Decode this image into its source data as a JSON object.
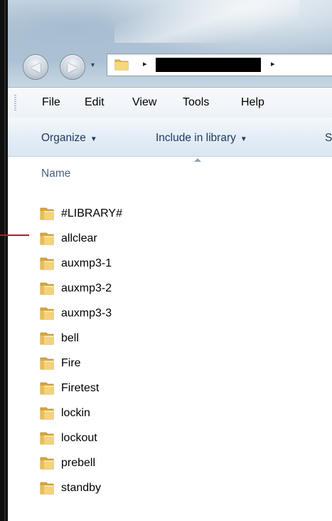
{
  "window": {
    "address_path_arrow_1": "▸",
    "address_path_arrow_2": "▸"
  },
  "navigation": {
    "back_icon": "arrow-left-icon",
    "forward_icon": "arrow-right-icon",
    "recent_icon": "chevron-down-icon"
  },
  "menubar": {
    "file": "File",
    "edit": "Edit",
    "view": "View",
    "tools": "Tools",
    "help": "Help"
  },
  "commandbar": {
    "organize": "Organize",
    "include_in_library": "Include in library",
    "share_truncated": "S",
    "caret": "▼"
  },
  "list": {
    "column_name": "Name",
    "items": [
      {
        "name": "#LIBRARY#"
      },
      {
        "name": "allclear"
      },
      {
        "name": "auxmp3-1"
      },
      {
        "name": "auxmp3-2"
      },
      {
        "name": "auxmp3-3"
      },
      {
        "name": "bell"
      },
      {
        "name": "Fire"
      },
      {
        "name": "Firetest"
      },
      {
        "name": "lockin"
      },
      {
        "name": "lockout"
      },
      {
        "name": "prebell"
      },
      {
        "name": "standby"
      }
    ]
  },
  "colors": {
    "annotation_red": "#c8102e",
    "folder_yellow": "#f0c860",
    "command_text": "#1e395b"
  }
}
